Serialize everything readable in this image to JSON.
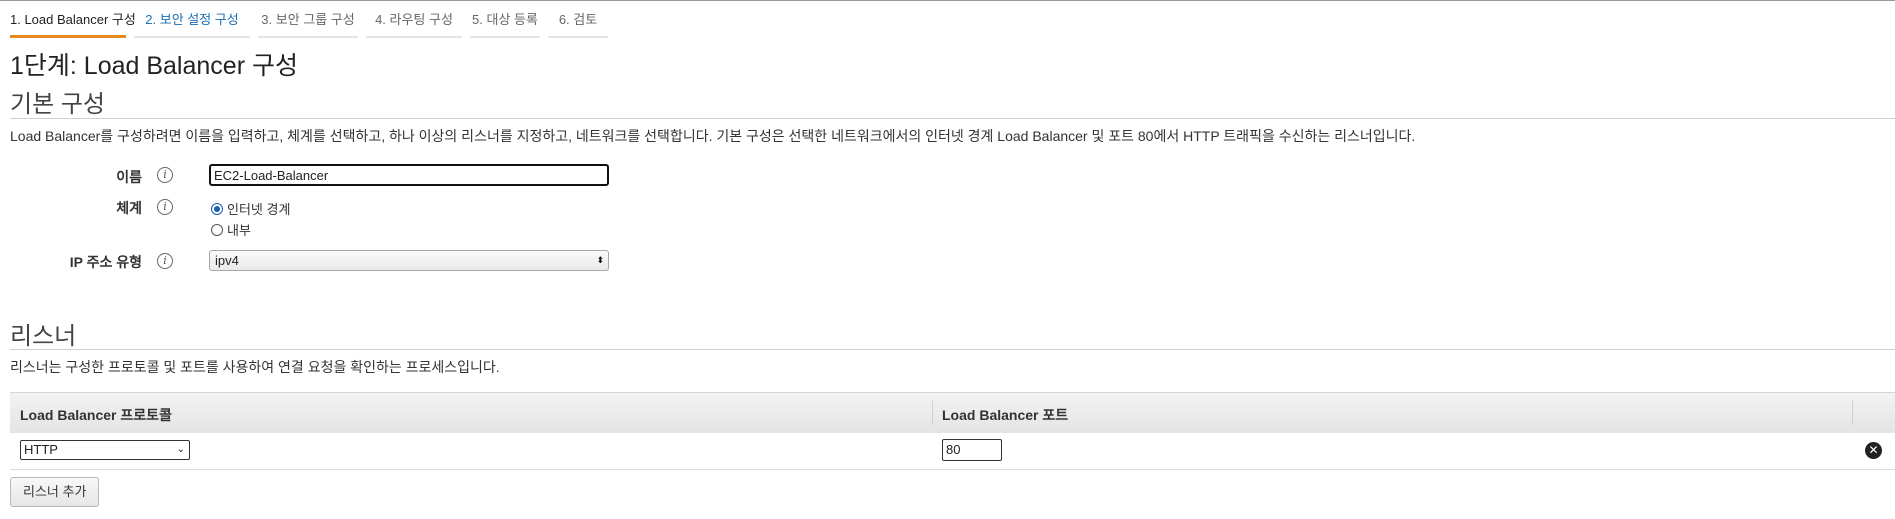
{
  "wizard": {
    "tabs": [
      {
        "label": "1. Load Balancer 구성",
        "state": "active"
      },
      {
        "label": "2. 보안 설정 구성",
        "state": "link"
      },
      {
        "label": "3. 보안 그룹 구성",
        "state": "inactive"
      },
      {
        "label": "4. 라우팅 구성",
        "state": "inactive"
      },
      {
        "label": "5. 대상 등록",
        "state": "inactive"
      },
      {
        "label": "6. 검토",
        "state": "inactive"
      }
    ]
  },
  "page": {
    "title": "1단계: Load Balancer 구성"
  },
  "basic": {
    "title": "기본 구성",
    "description": "Load Balancer를 구성하려면 이름을 입력하고, 체계를 선택하고, 하나 이상의 리스너를 지정하고, 네트워크를 선택합니다. 기본 구성은 선택한 네트워크에서의 인터넷 경계 Load Balancer 및 포트 80에서 HTTP 트래픽을 수신하는 리스너입니다.",
    "name_label": "이름",
    "name_value": "EC2-Load-Balancer",
    "scheme_label": "체계",
    "scheme_options": [
      {
        "label": "인터넷 경계",
        "checked": true
      },
      {
        "label": "내부",
        "checked": false
      }
    ],
    "ip_label": "IP 주소 유형",
    "ip_value": "ipv4",
    "info_glyph": "i"
  },
  "listeners": {
    "title": "리스너",
    "description": "리스너는 구성한 프로토콜 및 포트를 사용하여 연결 요청을 확인하는 프로세스입니다.",
    "col_protocol": "Load Balancer 프로토콜",
    "col_port": "Load Balancer 포트",
    "rows": [
      {
        "protocol": "HTTP",
        "port": "80"
      }
    ],
    "add_button": "리스너 추가"
  },
  "icons": {
    "info": "info-icon",
    "remove": "remove-circle-icon",
    "select_arrow": "select-arrow-icon"
  },
  "colors": {
    "active_tab_underline": "#e38b1d",
    "link": "#1a6fb5"
  }
}
